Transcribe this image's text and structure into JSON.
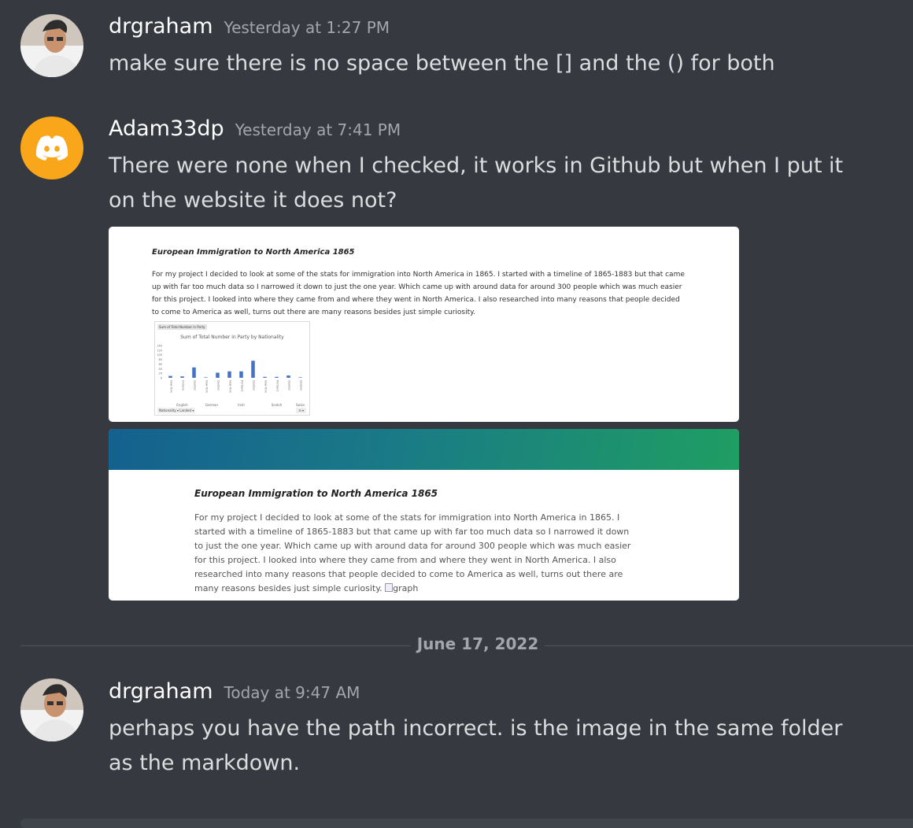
{
  "messages": [
    {
      "username": "drgraham",
      "timestamp": "Yesterday at 1:27 PM",
      "text": "make sure there is no space between the [] and the () for both"
    },
    {
      "username": "Adam33dp",
      "timestamp": "Yesterday at 7:41 PM",
      "text": "There were none when I checked, it works in Github but when I put it on the website it does not?"
    },
    {
      "username": "drgraham",
      "timestamp": "Today at 9:47 AM",
      "text": "perhaps you have the path incorrect. is the image in the same folder as the markdown."
    }
  ],
  "attachments": {
    "github": {
      "title": "European Immigration to North America 1865",
      "body": "For my project I decided to look at some of the stats for immigration into North America in 1865. I started with a timeline of 1865-1883 but that came up with far too much data so I narrowed it down to just the one year. Which came up with around data for around 300 people which was much easier for this project. I looked into where they came from and where they went in North America. I also researched into many reasons that people decided to come to America as well, turns out there are many reasons besides just simple curiosity.",
      "chart_tag": "Sum of Total Number in Party",
      "chart_title": "Sum of Total Number in Party by Nationality",
      "filter_label": "Nationality",
      "filter_label2": "Landed"
    },
    "website": {
      "title": "European Immigration to North America 1865",
      "body": "For my project I decided to look at some of the stats for immigration into North America in 1865. I started with a timeline of 1865-1883 but that came up with far too much data so I narrowed it down to just the one year. Which came up with around data for around 300 people which was much easier for this project. I looked into where they came from and where they went in North America. I also researched into many reasons that people decided to come to America as well, turns out there are many reasons besides just simple curiosity.",
      "broken_image_alt": "graph"
    }
  },
  "date_divider": "June 17, 2022",
  "chart_data": {
    "type": "bar",
    "title": "Sum of Total Number in Party by Nationality",
    "groups": [
      "English",
      "German",
      "Irish",
      "Scotch",
      "Swiss"
    ],
    "categories": [
      "New York",
      "Ontario",
      "Quebec",
      "New York",
      "Quebec",
      "New York",
      "Portland",
      "Quebec",
      "New York",
      "Portland",
      "Quebec",
      "Quebec"
    ],
    "values": [
      8,
      6,
      45,
      2,
      22,
      28,
      28,
      74,
      4,
      4,
      10,
      2
    ],
    "ylim": [
      0,
      140
    ],
    "yticks": [
      "140",
      "120",
      "100",
      "80",
      "60",
      "40",
      "20",
      "0"
    ],
    "bar_color": "#4472c4"
  }
}
